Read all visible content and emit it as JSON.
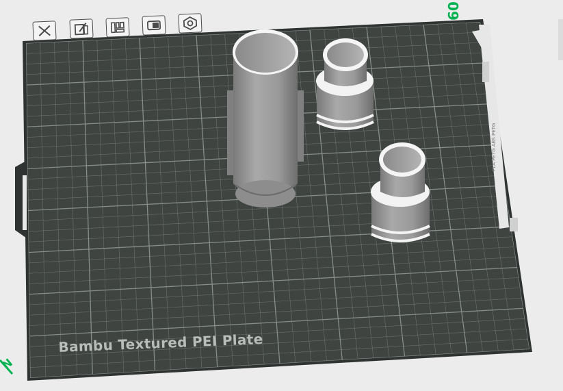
{
  "toolbar": {
    "items": [
      {
        "name": "delete-icon"
      },
      {
        "name": "auto-orient-icon"
      },
      {
        "name": "arrange-icon"
      },
      {
        "name": "layer-settings-icon"
      },
      {
        "name": "plate-settings-icon"
      }
    ]
  },
  "plate": {
    "name": "Bambu Textured PEI Plate",
    "surface_color": "#3f4441",
    "grid_color": "#8e958f",
    "edge_color": "#2f3331"
  },
  "axis": {
    "y_label": "09",
    "x_label": "N",
    "color": "#00b350"
  },
  "side_strip": {
    "label": "PLA PETG ABS PETG"
  },
  "objects": [
    {
      "name": "tall-cylinder-object",
      "color": "#9b9b9b"
    },
    {
      "name": "adapter-object-top",
      "color": "#9b9b9b"
    },
    {
      "name": "adapter-object-bottom",
      "color": "#9b9b9b"
    }
  ]
}
